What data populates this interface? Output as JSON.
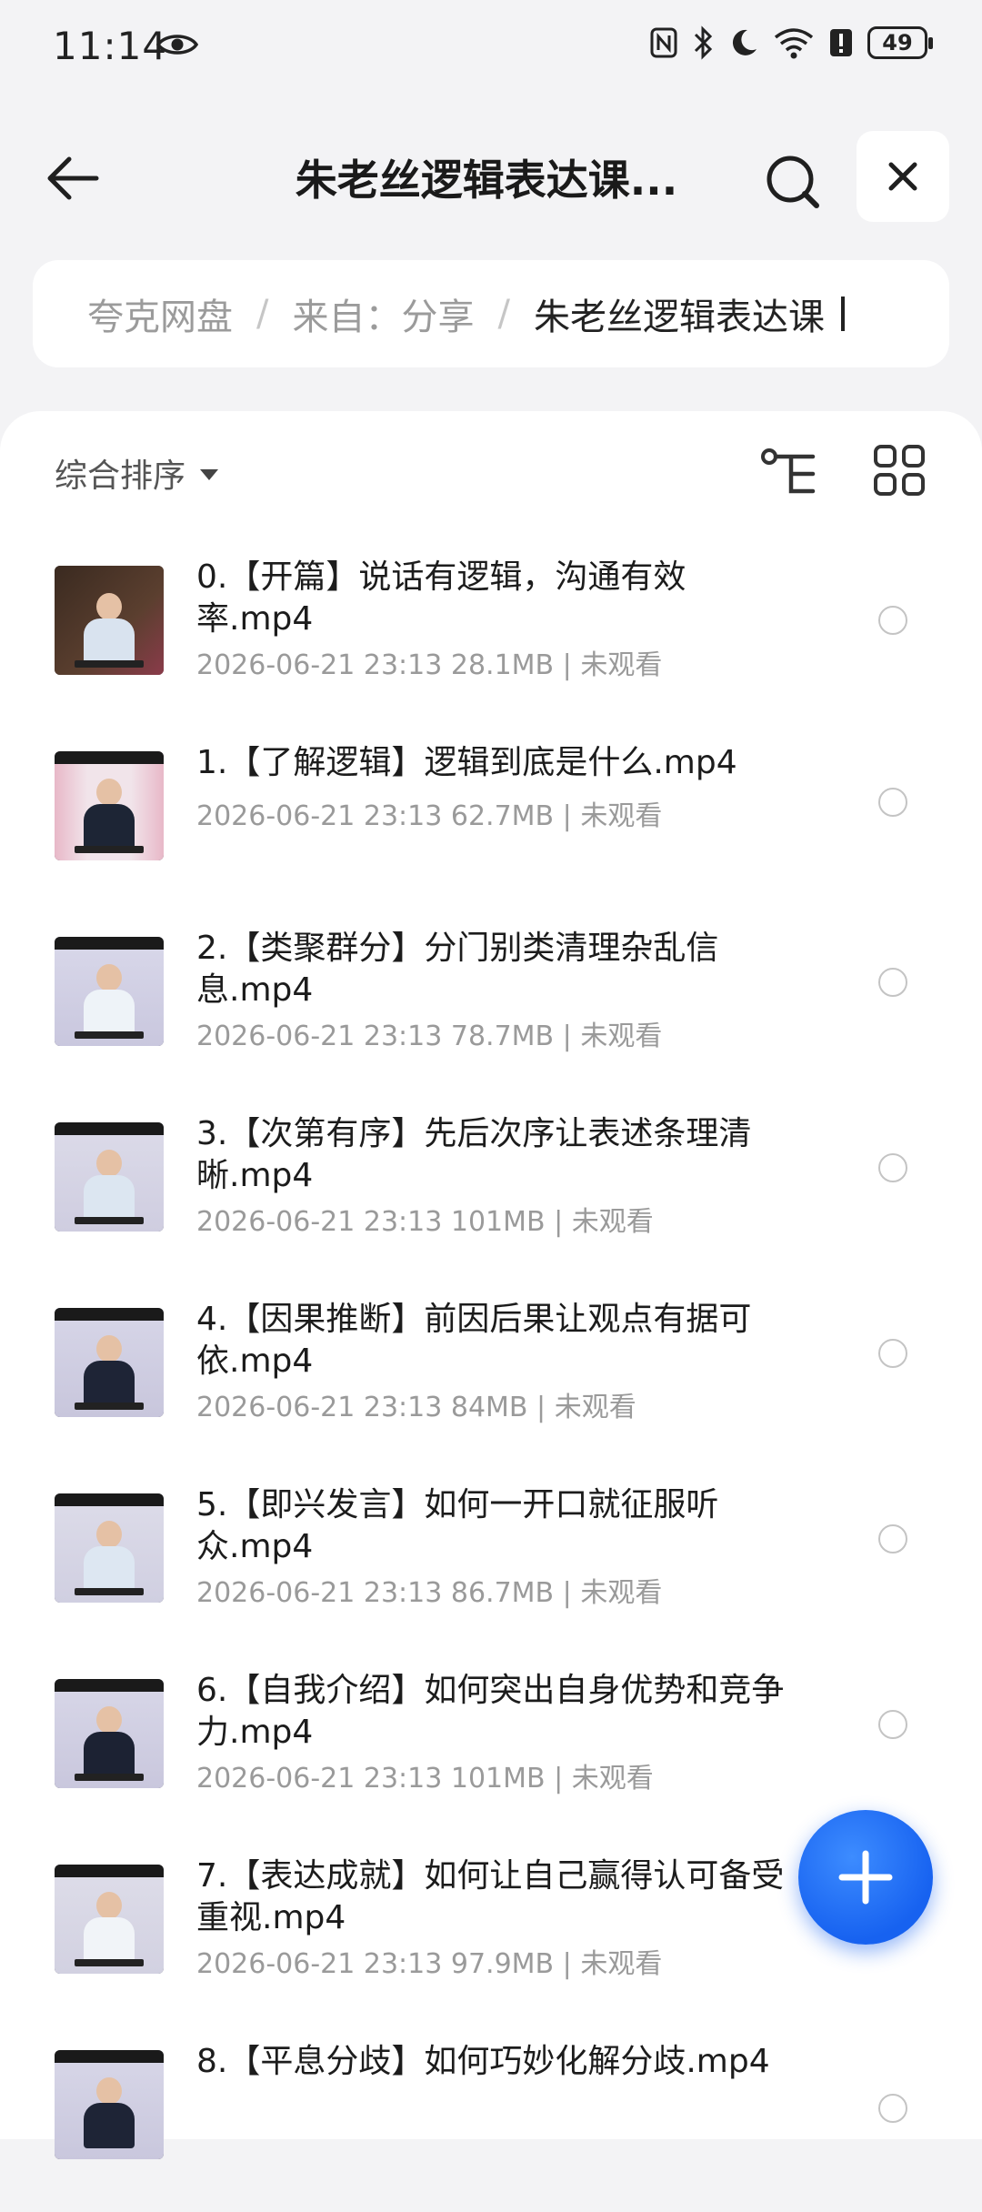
{
  "status_bar": {
    "time": "11:14",
    "battery": "49"
  },
  "header": {
    "title": "朱老丝逻辑表达课..."
  },
  "breadcrumb": {
    "items": [
      "夸克网盘",
      "来自：分享"
    ],
    "current": "朱老丝逻辑表达课"
  },
  "toolbar": {
    "sort_label": "综合排序"
  },
  "files": [
    {
      "name": "0.【开篇】说话有逻辑，沟通有效率.mp4",
      "meta": "2026-06-21 23:13  28.1MB | 未观看"
    },
    {
      "name": "1.【了解逻辑】逻辑到底是什么.mp4",
      "meta": "2026-06-21 23:13  62.7MB | 未观看"
    },
    {
      "name": "2.【类聚群分】分门别类清理杂乱信息.mp4",
      "meta": "2026-06-21 23:13  78.7MB | 未观看"
    },
    {
      "name": "3.【次第有序】先后次序让表述条理清晰.mp4",
      "meta": "2026-06-21 23:13  101MB | 未观看"
    },
    {
      "name": "4.【因果推断】前因后果让观点有据可依.mp4",
      "meta": "2026-06-21 23:13  84MB | 未观看"
    },
    {
      "name": "5.【即兴发言】如何一开口就征服听众.mp4",
      "meta": "2026-06-21 23:13  86.7MB | 未观看"
    },
    {
      "name": "6.【自我介绍】如何突出自身优势和竞争力.mp4",
      "meta": "2026-06-21 23:13  101MB | 未观看"
    },
    {
      "name": "7.【表达成就】如何让自己赢得认可备受重视.mp4",
      "meta": "2026-06-21 23:13  97.9MB | 未观看"
    },
    {
      "name": "8.【平息分歧】如何巧妙化解分歧.mp4",
      "meta": ""
    }
  ],
  "colors": {
    "accent": "#1762f0",
    "background": "#f3f3f5"
  }
}
